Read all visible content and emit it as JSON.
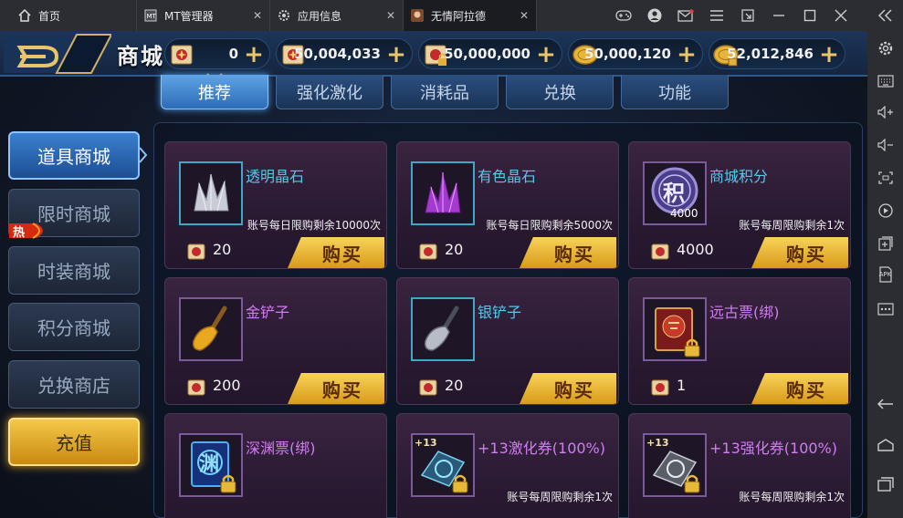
{
  "tabs": [
    {
      "label": "首页",
      "icon": "home-icon"
    },
    {
      "label": "MT管理器",
      "icon": "mt-manager-icon"
    },
    {
      "label": "应用信息",
      "icon": "gear-icon"
    },
    {
      "label": "无情阿拉德",
      "icon": "game-icon"
    }
  ],
  "sidebar_apk": "APK",
  "header": {
    "title": "商城",
    "resources": [
      {
        "icon": "ticket-scroll-icon",
        "value": "0"
      },
      {
        "icon": "ticket-scroll-icon",
        "value": "50,004,033"
      },
      {
        "icon": "locked-ticket-scroll-icon",
        "value": "50,000,000"
      },
      {
        "icon": "gold-coin-icon",
        "value": "50,000,120"
      },
      {
        "icon": "locked-gold-coin-icon",
        "value": "52,012,846"
      }
    ]
  },
  "categories": [
    "推荐",
    "强化激化",
    "消耗品",
    "兑换",
    "功能"
  ],
  "active_category": "推荐",
  "left_menu": [
    {
      "label": "道具商城",
      "active": true
    },
    {
      "label": "限时商城"
    },
    {
      "label": "时装商城"
    },
    {
      "label": "积分商城"
    },
    {
      "label": "兑换商店"
    },
    {
      "label": "充值"
    }
  ],
  "hot_badge": "热",
  "buy_label": "购买",
  "products": [
    {
      "name": "透明晶石",
      "color": "cyan",
      "limit": "账号每日限购剩余10000次",
      "price": "20",
      "icon": "clear-crystal-icon"
    },
    {
      "name": "有色晶石",
      "color": "cyan",
      "limit": "账号每日限购剩余5000次",
      "price": "20",
      "icon": "purple-crystal-icon"
    },
    {
      "name": "商城积分",
      "color": "cyan",
      "limit": "账号每周限购剩余1次",
      "price": "4000",
      "icon": "points-coin-icon",
      "badge": "4000",
      "badge_char": "积"
    },
    {
      "name": "金铲子",
      "color": "purple",
      "limit": "",
      "price": "200",
      "icon": "gold-shovel-icon"
    },
    {
      "name": "银铲子",
      "color": "cyan",
      "limit": "",
      "price": "20",
      "icon": "silver-shovel-icon"
    },
    {
      "name": "远古票(绑)",
      "color": "purple",
      "limit": "",
      "price": "1",
      "icon": "ancient-ticket-icon"
    },
    {
      "name": "深渊票(绑)",
      "color": "purple",
      "limit": "",
      "price": "",
      "icon": "abyss-ticket-icon",
      "badge_char": "渊"
    },
    {
      "name": "+13激化券(100%)",
      "color": "purple",
      "limit": "账号每周限购剩余1次",
      "price": "",
      "icon": "amplify-scroll-icon",
      "badge": "+13"
    },
    {
      "name": "+13强化券(100%)",
      "color": "purple",
      "limit": "账号每周限购剩余1次",
      "price": "",
      "icon": "reinforce-scroll-icon",
      "badge": "+13"
    }
  ],
  "colors": {
    "accent_blue": "#2d6cb6",
    "gold": "#d99a18",
    "purple_text": "#d27cf2",
    "cyan_text": "#56c8ea"
  }
}
